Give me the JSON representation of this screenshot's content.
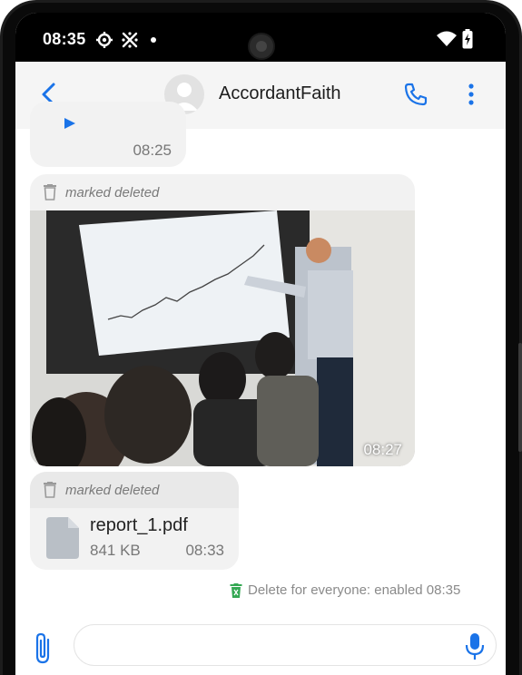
{
  "status_bar": {
    "time": "08:35"
  },
  "header": {
    "contact_name": "AccordantFaith"
  },
  "messages": [
    {
      "type": "audio",
      "time": "08:25"
    },
    {
      "type": "image",
      "deleted_label": "marked deleted",
      "time": "08:27"
    },
    {
      "type": "file",
      "deleted_label": "marked deleted",
      "file_name": "report_1.pdf",
      "file_size": "841 KB",
      "time": "08:33"
    }
  ],
  "system_notice": {
    "text": "Delete for everyone: enabled 08:35"
  },
  "input": {
    "placeholder": ""
  },
  "colors": {
    "accent": "#1a73e8",
    "bubble": "#f2f2f2",
    "notice_icon": "#34a853"
  }
}
